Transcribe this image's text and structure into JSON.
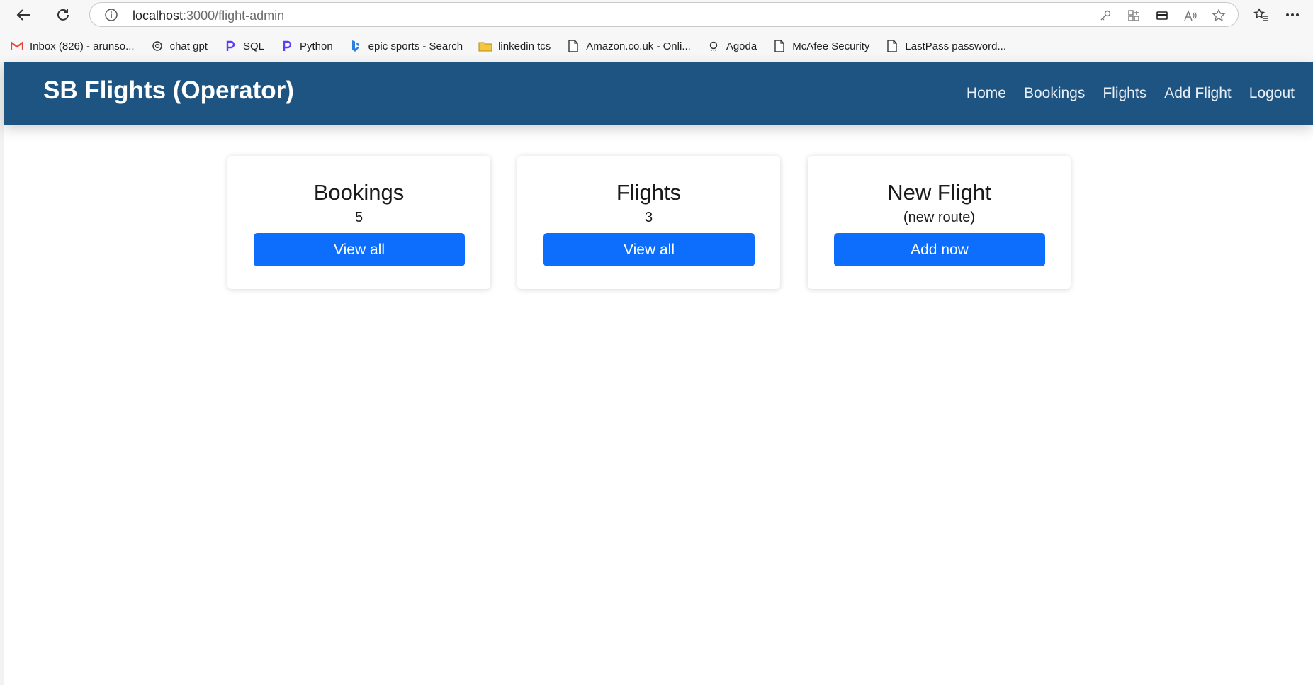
{
  "browser": {
    "url_host": "localhost",
    "url_path": ":3000/flight-admin",
    "bookmarks": [
      {
        "label": "Inbox (826) - arunso...",
        "icon": "gmail-icon"
      },
      {
        "label": "chat gpt",
        "icon": "openai-icon"
      },
      {
        "label": "SQL",
        "icon": "p-logo-icon"
      },
      {
        "label": "Python",
        "icon": "p-logo-icon"
      },
      {
        "label": "epic sports - Search",
        "icon": "bing-icon"
      },
      {
        "label": "linkedin tcs",
        "icon": "folder-icon"
      },
      {
        "label": "Amazon.co.uk - Onli...",
        "icon": "page-icon"
      },
      {
        "label": "Agoda",
        "icon": "agoda-icon"
      },
      {
        "label": "McAfee Security",
        "icon": "page-icon"
      },
      {
        "label": "LastPass password...",
        "icon": "page-icon"
      }
    ]
  },
  "navbar": {
    "brand": "SB Flights (Operator)",
    "links": [
      "Home",
      "Bookings",
      "Flights",
      "Add Flight",
      "Logout"
    ],
    "bg": "#1e5482"
  },
  "cards": [
    {
      "title": "Bookings",
      "value": "5",
      "button": "View all"
    },
    {
      "title": "Flights",
      "value": "3",
      "button": "View all"
    },
    {
      "title": "New Flight",
      "value": "(new route)",
      "button": "Add now"
    }
  ],
  "colors": {
    "primary_button": "#0d6efd"
  }
}
